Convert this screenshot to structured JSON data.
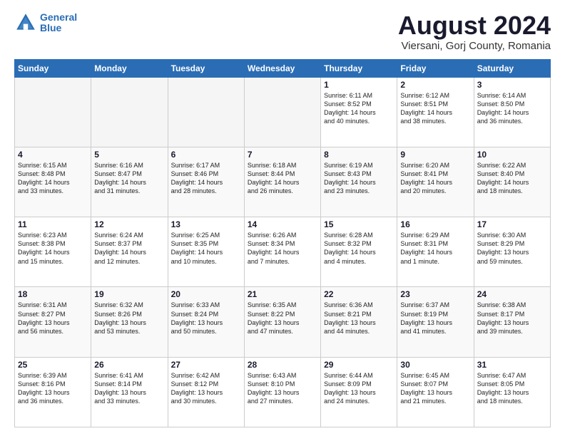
{
  "header": {
    "logo_line1": "General",
    "logo_line2": "Blue",
    "month_year": "August 2024",
    "location": "Viersani, Gorj County, Romania"
  },
  "weekdays": [
    "Sunday",
    "Monday",
    "Tuesday",
    "Wednesday",
    "Thursday",
    "Friday",
    "Saturday"
  ],
  "weeks": [
    [
      {
        "day": "",
        "info": ""
      },
      {
        "day": "",
        "info": ""
      },
      {
        "day": "",
        "info": ""
      },
      {
        "day": "",
        "info": ""
      },
      {
        "day": "1",
        "info": "Sunrise: 6:11 AM\nSunset: 8:52 PM\nDaylight: 14 hours\nand 40 minutes."
      },
      {
        "day": "2",
        "info": "Sunrise: 6:12 AM\nSunset: 8:51 PM\nDaylight: 14 hours\nand 38 minutes."
      },
      {
        "day": "3",
        "info": "Sunrise: 6:14 AM\nSunset: 8:50 PM\nDaylight: 14 hours\nand 36 minutes."
      }
    ],
    [
      {
        "day": "4",
        "info": "Sunrise: 6:15 AM\nSunset: 8:48 PM\nDaylight: 14 hours\nand 33 minutes."
      },
      {
        "day": "5",
        "info": "Sunrise: 6:16 AM\nSunset: 8:47 PM\nDaylight: 14 hours\nand 31 minutes."
      },
      {
        "day": "6",
        "info": "Sunrise: 6:17 AM\nSunset: 8:46 PM\nDaylight: 14 hours\nand 28 minutes."
      },
      {
        "day": "7",
        "info": "Sunrise: 6:18 AM\nSunset: 8:44 PM\nDaylight: 14 hours\nand 26 minutes."
      },
      {
        "day": "8",
        "info": "Sunrise: 6:19 AM\nSunset: 8:43 PM\nDaylight: 14 hours\nand 23 minutes."
      },
      {
        "day": "9",
        "info": "Sunrise: 6:20 AM\nSunset: 8:41 PM\nDaylight: 14 hours\nand 20 minutes."
      },
      {
        "day": "10",
        "info": "Sunrise: 6:22 AM\nSunset: 8:40 PM\nDaylight: 14 hours\nand 18 minutes."
      }
    ],
    [
      {
        "day": "11",
        "info": "Sunrise: 6:23 AM\nSunset: 8:38 PM\nDaylight: 14 hours\nand 15 minutes."
      },
      {
        "day": "12",
        "info": "Sunrise: 6:24 AM\nSunset: 8:37 PM\nDaylight: 14 hours\nand 12 minutes."
      },
      {
        "day": "13",
        "info": "Sunrise: 6:25 AM\nSunset: 8:35 PM\nDaylight: 14 hours\nand 10 minutes."
      },
      {
        "day": "14",
        "info": "Sunrise: 6:26 AM\nSunset: 8:34 PM\nDaylight: 14 hours\nand 7 minutes."
      },
      {
        "day": "15",
        "info": "Sunrise: 6:28 AM\nSunset: 8:32 PM\nDaylight: 14 hours\nand 4 minutes."
      },
      {
        "day": "16",
        "info": "Sunrise: 6:29 AM\nSunset: 8:31 PM\nDaylight: 14 hours\nand 1 minute."
      },
      {
        "day": "17",
        "info": "Sunrise: 6:30 AM\nSunset: 8:29 PM\nDaylight: 13 hours\nand 59 minutes."
      }
    ],
    [
      {
        "day": "18",
        "info": "Sunrise: 6:31 AM\nSunset: 8:27 PM\nDaylight: 13 hours\nand 56 minutes."
      },
      {
        "day": "19",
        "info": "Sunrise: 6:32 AM\nSunset: 8:26 PM\nDaylight: 13 hours\nand 53 minutes."
      },
      {
        "day": "20",
        "info": "Sunrise: 6:33 AM\nSunset: 8:24 PM\nDaylight: 13 hours\nand 50 minutes."
      },
      {
        "day": "21",
        "info": "Sunrise: 6:35 AM\nSunset: 8:22 PM\nDaylight: 13 hours\nand 47 minutes."
      },
      {
        "day": "22",
        "info": "Sunrise: 6:36 AM\nSunset: 8:21 PM\nDaylight: 13 hours\nand 44 minutes."
      },
      {
        "day": "23",
        "info": "Sunrise: 6:37 AM\nSunset: 8:19 PM\nDaylight: 13 hours\nand 41 minutes."
      },
      {
        "day": "24",
        "info": "Sunrise: 6:38 AM\nSunset: 8:17 PM\nDaylight: 13 hours\nand 39 minutes."
      }
    ],
    [
      {
        "day": "25",
        "info": "Sunrise: 6:39 AM\nSunset: 8:16 PM\nDaylight: 13 hours\nand 36 minutes."
      },
      {
        "day": "26",
        "info": "Sunrise: 6:41 AM\nSunset: 8:14 PM\nDaylight: 13 hours\nand 33 minutes."
      },
      {
        "day": "27",
        "info": "Sunrise: 6:42 AM\nSunset: 8:12 PM\nDaylight: 13 hours\nand 30 minutes."
      },
      {
        "day": "28",
        "info": "Sunrise: 6:43 AM\nSunset: 8:10 PM\nDaylight: 13 hours\nand 27 minutes."
      },
      {
        "day": "29",
        "info": "Sunrise: 6:44 AM\nSunset: 8:09 PM\nDaylight: 13 hours\nand 24 minutes."
      },
      {
        "day": "30",
        "info": "Sunrise: 6:45 AM\nSunset: 8:07 PM\nDaylight: 13 hours\nand 21 minutes."
      },
      {
        "day": "31",
        "info": "Sunrise: 6:47 AM\nSunset: 8:05 PM\nDaylight: 13 hours\nand 18 minutes."
      }
    ]
  ]
}
